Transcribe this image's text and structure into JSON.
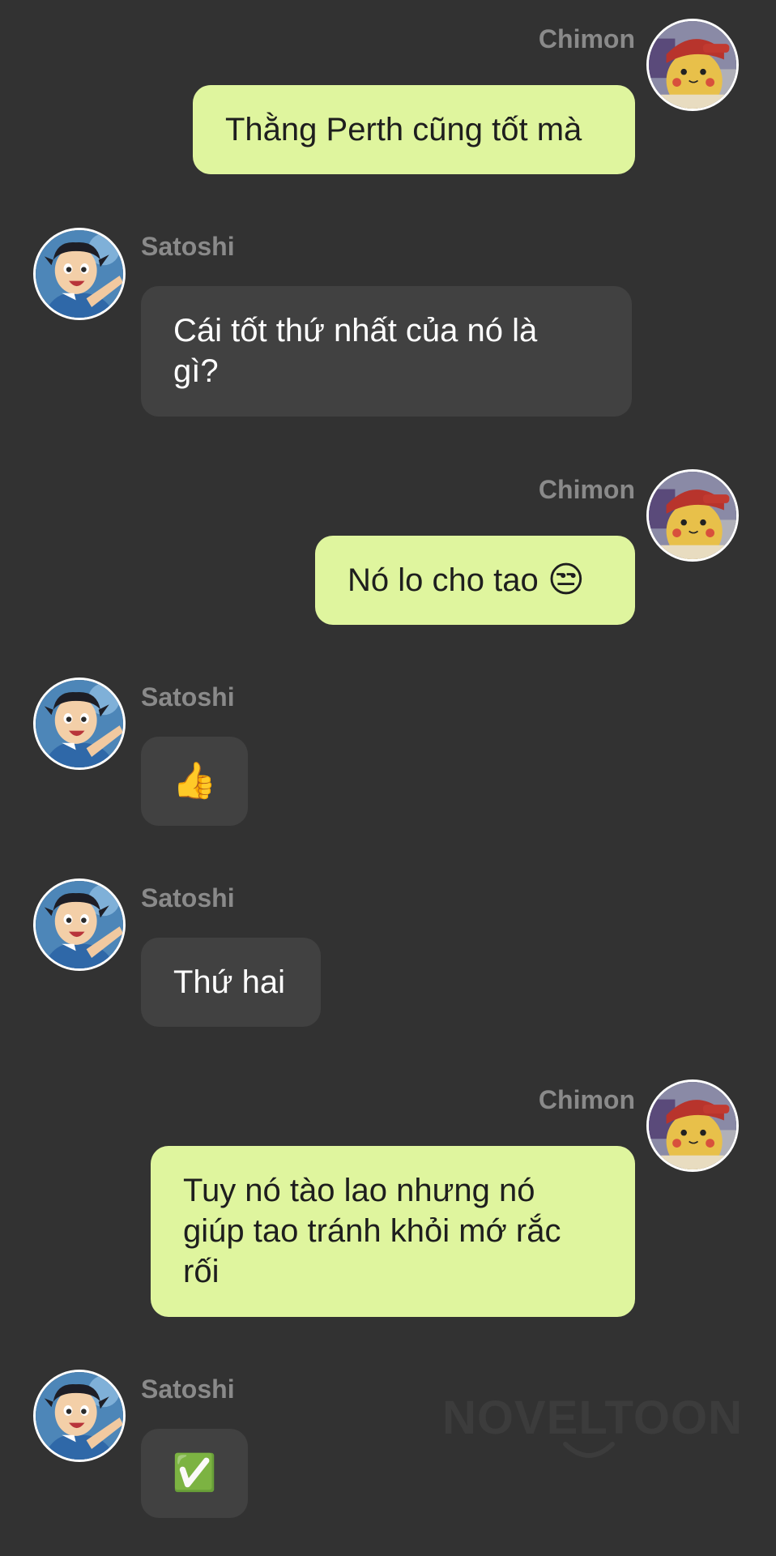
{
  "users": {
    "me": {
      "name": "Chimon",
      "avatar_icon": "pikachu-hat-avatar-icon"
    },
    "other": {
      "name": "Satoshi",
      "avatar_icon": "ash-avatar-icon"
    }
  },
  "messages": [
    {
      "sender": "Chimon",
      "text": "Thằng Perth cũng tốt mà"
    },
    {
      "sender": "Satoshi",
      "text": "Cái tốt thứ nhất của nó là gì?"
    },
    {
      "sender": "Chimon",
      "text": "Nó lo cho tao",
      "emoji": "😒"
    },
    {
      "sender": "Satoshi",
      "emoji": "👍"
    },
    {
      "sender": "Satoshi",
      "text": "Thứ hai"
    },
    {
      "sender": "Chimon",
      "text": "Tuy nó tào lao nhưng nó giúp tao tránh khỏi mớ rắc rối"
    },
    {
      "sender": "Satoshi",
      "emoji": "✅"
    }
  ],
  "watermark": "NOVELTOON",
  "colors": {
    "background": "#323232",
    "my_bubble": "#dff59e",
    "their_bubble": "#414141",
    "name_label": "#8a8a8a"
  }
}
